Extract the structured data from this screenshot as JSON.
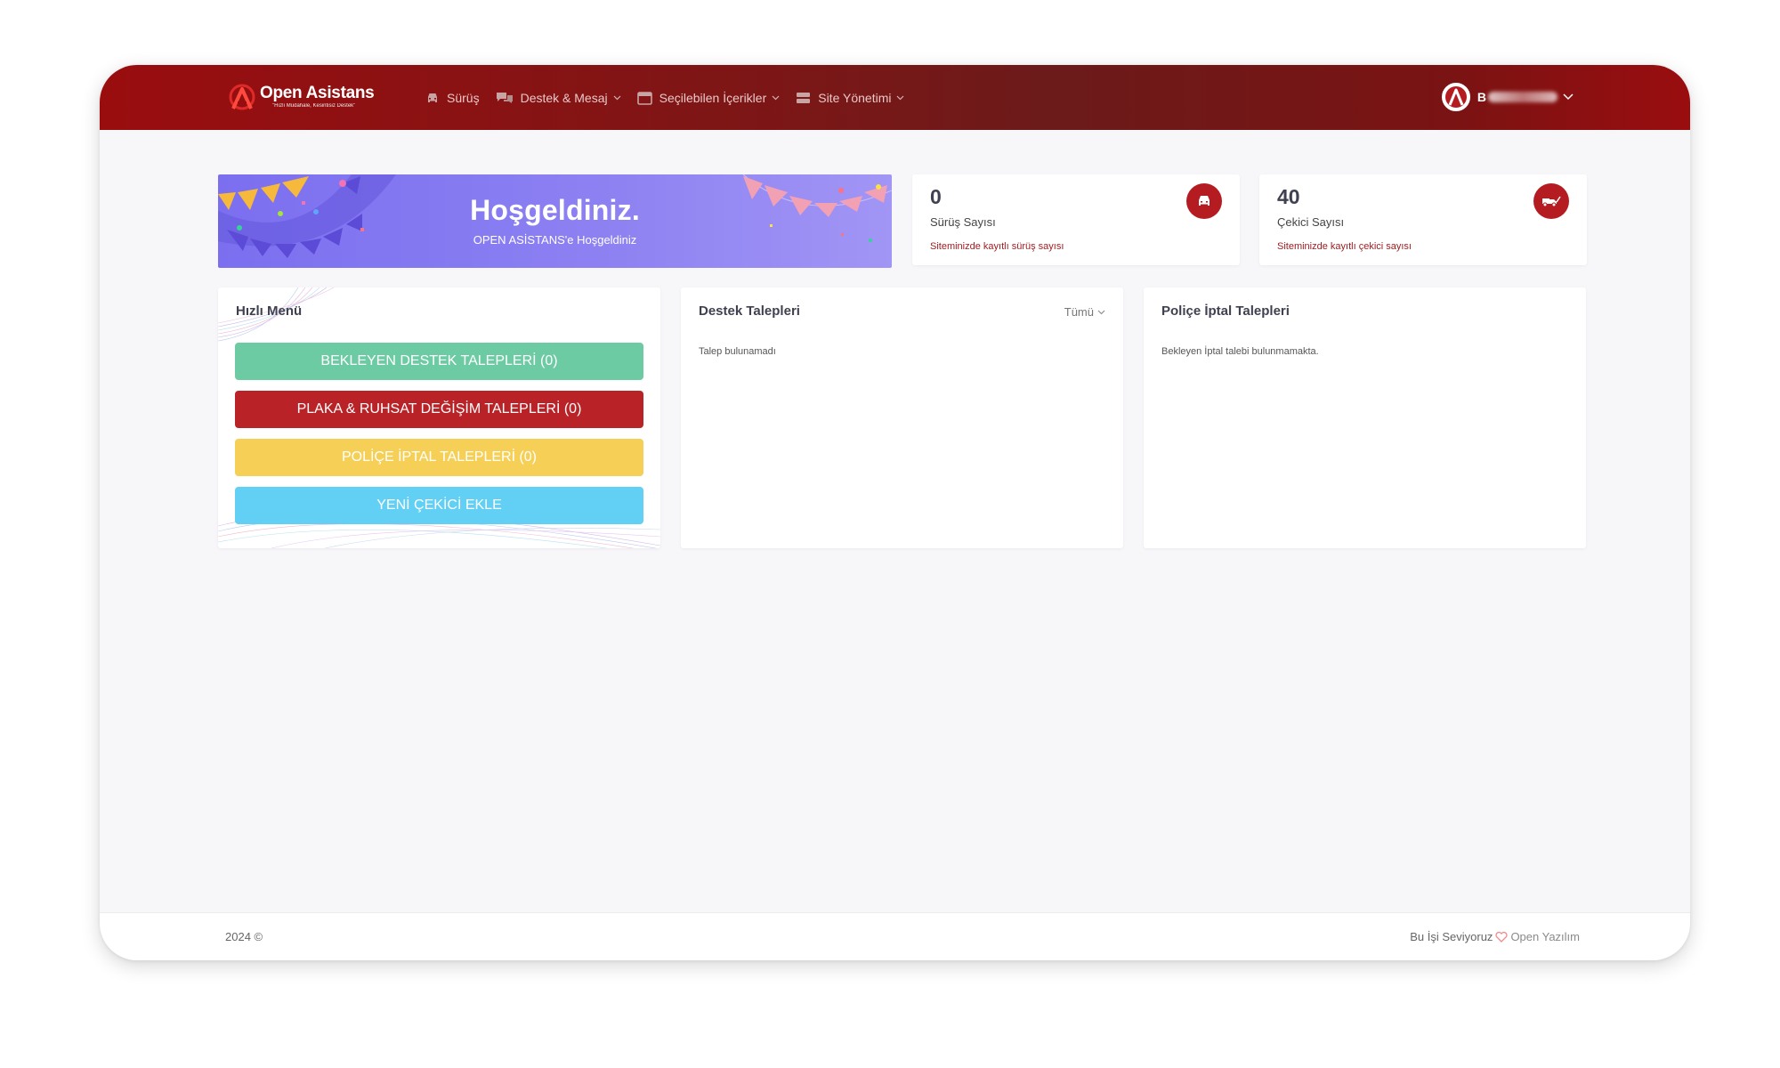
{
  "colors": {
    "brand_red": "#9a0d0f",
    "stat_icon_bg": "#b51c21",
    "banner_purple": "#7b6ff0",
    "btn_green": "#6dcba3",
    "btn_red": "#b92327",
    "btn_yellow": "#f6cf57",
    "btn_cyan": "#62d0f4"
  },
  "header": {
    "logo": {
      "name": "Open Asistans",
      "tagline": "\"Hızlı Müdahale, Kesintisiz Destek\"",
      "icon": "brand-logo-icon"
    },
    "nav": [
      {
        "label": "Sürüş",
        "icon": "car-icon",
        "has_dropdown": false
      },
      {
        "label": "Destek & Mesaj",
        "icon": "chat-bubbles-icon",
        "has_dropdown": true
      },
      {
        "label": "Seçilebilen İçerikler",
        "icon": "window-icon",
        "has_dropdown": true
      },
      {
        "label": "Site Yönetimi",
        "icon": "server-icon",
        "has_dropdown": true
      }
    ],
    "user": {
      "initial": "B",
      "icon": "user-avatar-icon"
    }
  },
  "banner": {
    "title": "Hoşgeldiniz.",
    "subtitle": "OPEN ASİSTANS'e Hoşgeldiniz"
  },
  "stats": [
    {
      "value": "0",
      "label": "Sürüş Sayısı",
      "note": "Siteminizde kayıtlı sürüş sayısı",
      "icon": "car-icon"
    },
    {
      "value": "40",
      "label": "Çekici Sayısı",
      "note": "Siteminizde kayıtlı çekici sayısı",
      "icon": "tow-truck-icon"
    }
  ],
  "quick_menu": {
    "title": "Hızlı Menü",
    "buttons": [
      {
        "label": "BEKLEYEN DESTEK TALEPLERİ (0)"
      },
      {
        "label": "PLAKA & RUHSAT DEĞİŞİM TALEPLERİ (0)"
      },
      {
        "label": "POLİÇE İPTAL TALEPLERİ (0)"
      },
      {
        "label": "YENİ ÇEKİCİ EKLE"
      }
    ]
  },
  "support_requests": {
    "title": "Destek Talepleri",
    "filter": "Tümü",
    "empty": "Talep bulunamadı"
  },
  "policy_cancel": {
    "title": "Poliçe İptal Talepleri",
    "empty": "Bekleyen İptal talebi bulunmamakta."
  },
  "footer": {
    "copyright": "2024 ©",
    "credit_text": "Bu İşi Seviyoruz",
    "company": "Open Yazılım"
  }
}
